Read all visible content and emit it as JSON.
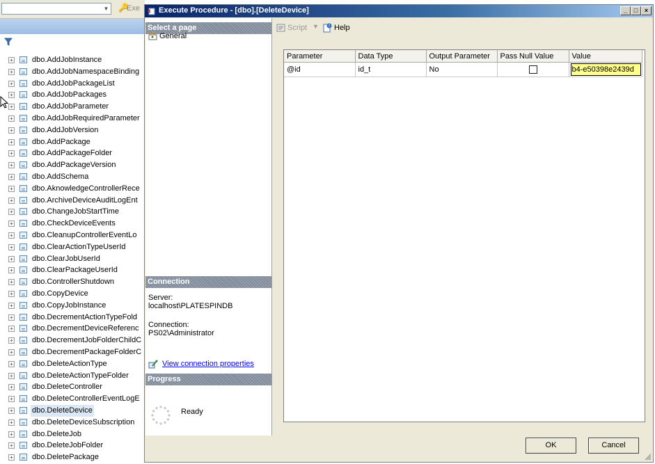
{
  "explorer": {
    "toolbar_exec_label": "Exe",
    "items": [
      {
        "label": "dbo.AddJobInstance"
      },
      {
        "label": "dbo.AddJobNamespaceBinding"
      },
      {
        "label": "dbo.AddJobPackageList"
      },
      {
        "label": "dbo.AddJobPackages"
      },
      {
        "label": "dbo.AddJobParameter"
      },
      {
        "label": "dbo.AddJobRequiredParameter"
      },
      {
        "label": "dbo.AddJobVersion"
      },
      {
        "label": "dbo.AddPackage"
      },
      {
        "label": "dbo.AddPackageFolder"
      },
      {
        "label": "dbo.AddPackageVersion"
      },
      {
        "label": "dbo.AddSchema"
      },
      {
        "label": "dbo.AknowledgeControllerRece"
      },
      {
        "label": "dbo.ArchiveDeviceAuditLogEnt"
      },
      {
        "label": "dbo.ChangeJobStartTime"
      },
      {
        "label": "dbo.CheckDeviceEvents"
      },
      {
        "label": "dbo.CleanupControllerEventLo"
      },
      {
        "label": "dbo.ClearActionTypeUserId"
      },
      {
        "label": "dbo.ClearJobUserId"
      },
      {
        "label": "dbo.ClearPackageUserId"
      },
      {
        "label": "dbo.ControllerShutdown"
      },
      {
        "label": "dbo.CopyDevice"
      },
      {
        "label": "dbo.CopyJobInstance"
      },
      {
        "label": "dbo.DecrementActionTypeFold"
      },
      {
        "label": "dbo.DecrementDeviceReferenc"
      },
      {
        "label": "dbo.DecrementJobFolderChildC"
      },
      {
        "label": "dbo.DecrementPackageFolderC"
      },
      {
        "label": "dbo.DeleteActionType"
      },
      {
        "label": "dbo.DeleteActionTypeFolder"
      },
      {
        "label": "dbo.DeleteController"
      },
      {
        "label": "dbo.DeleteControllerEventLogE"
      },
      {
        "label": "dbo.DeleteDevice"
      },
      {
        "label": "dbo.DeleteDeviceSubscription"
      },
      {
        "label": "dbo.DeleteJob"
      },
      {
        "label": "dbo.DeleteJobFolder"
      },
      {
        "label": "dbo.DeletePackage"
      }
    ],
    "selected_item": "dbo.DeleteDevice",
    "expand_glyph": "+"
  },
  "dialog": {
    "title": "Execute Procedure - [dbo].[DeleteDevice]",
    "select_page_header": "Select a page",
    "page_general": "General",
    "toolbar": {
      "script_label": "Script",
      "help_label": "Help"
    },
    "connection_header": "Connection",
    "server_label": "Server:",
    "server_value": "localhost\\PLATESPINDB",
    "connection_label": "Connection:",
    "connection_value": "PS02\\Administrator",
    "view_connection_properties": "View connection properties",
    "progress_header": "Progress",
    "progress_status": "Ready",
    "grid": {
      "columns": [
        "Parameter",
        "Data Type",
        "Output Parameter",
        "Pass Null Value",
        "Value"
      ],
      "rows": [
        {
          "parameter": "@id",
          "data_type": "id_t",
          "output_parameter": "No",
          "pass_null_value": false,
          "value": "b4-e50398e2439d"
        }
      ]
    },
    "ok_label": "OK",
    "cancel_label": "Cancel"
  },
  "colors": {
    "title_start": "#0a246a",
    "title_end": "#a6caf0",
    "value_highlight": "#ffff8a",
    "link": "#0000ee",
    "pane_header": "#7f8a9a"
  },
  "icons": [
    "key-icon",
    "filter-icon",
    "stored-procedure-icon",
    "general-page-icon",
    "script-icon",
    "help-icon",
    "connection-properties-icon",
    "progress-spinner-icon",
    "size-grip-icon"
  ]
}
